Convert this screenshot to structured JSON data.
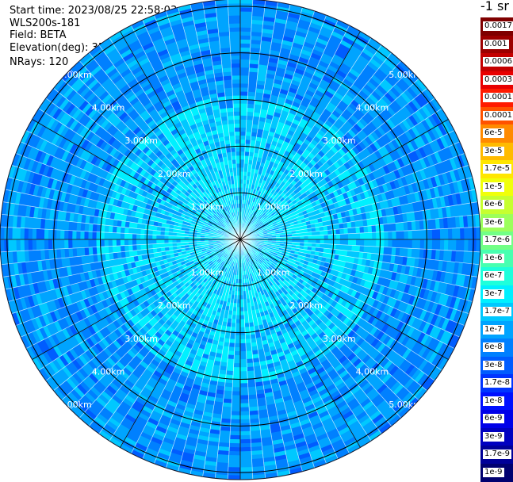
{
  "header": {
    "start_time": "Start time: 2023/08/25 22:58:03",
    "instrument": "WLS200s-181",
    "field": "Field: BETA",
    "elevation": "Elevation(deg): 35.30",
    "nrays": "NRays: 120"
  },
  "colorbar": {
    "unit": "-1 sr",
    "entries": [
      {
        "label": "0.0017",
        "color": "#7f0000"
      },
      {
        "label": "0.001",
        "color": "#9c0000"
      },
      {
        "label": "0.0006",
        "color": "#c40000"
      },
      {
        "label": "0.0003",
        "color": "#e80000"
      },
      {
        "label": "0.00017",
        "color": "#ff1a00"
      },
      {
        "label": "0.0001",
        "color": "#ff5200"
      },
      {
        "label": "6e-5",
        "color": "#ff8a00"
      },
      {
        "label": "3e-5",
        "color": "#ffbb00"
      },
      {
        "label": "1.7e-5",
        "color": "#ffe600"
      },
      {
        "label": "1e-5",
        "color": "#f0ff0a"
      },
      {
        "label": "6e-6",
        "color": "#c6ff30"
      },
      {
        "label": "3e-6",
        "color": "#9cff5b"
      },
      {
        "label": "1.7e-6",
        "color": "#72ff86"
      },
      {
        "label": "1e-6",
        "color": "#48ffb0"
      },
      {
        "label": "6e-7",
        "color": "#1effdb"
      },
      {
        "label": "3e-7",
        "color": "#00f0ff"
      },
      {
        "label": "1.7e-7",
        "color": "#00c8ff"
      },
      {
        "label": "1e-7",
        "color": "#00a4ff"
      },
      {
        "label": "6e-8",
        "color": "#0080ff"
      },
      {
        "label": "3e-8",
        "color": "#005cff"
      },
      {
        "label": "1.7e-8",
        "color": "#0034ff"
      },
      {
        "label": "1e-8",
        "color": "#0010ff"
      },
      {
        "label": "6e-9",
        "color": "#0000e8"
      },
      {
        "label": "3e-9",
        "color": "#0000c0"
      },
      {
        "label": "1.7e-9",
        "color": "#000098"
      },
      {
        "label": "1e-9",
        "color": "#000070"
      }
    ]
  },
  "chart_data": {
    "type": "heatmap",
    "projection": "polar PPI",
    "rays": 120,
    "field": "BETA",
    "range_rings_km": [
      1,
      2,
      3,
      4,
      5
    ],
    "range_ring_labels": [
      "1.00km",
      "2.00km",
      "3.00km",
      "4.00km",
      "5.00km"
    ],
    "dominant_levels": [
      "6e-8",
      "1e-7",
      "1.7e-7",
      "3e-7"
    ],
    "near_range_level": "3e-7",
    "far_range_level": "6e-8"
  }
}
